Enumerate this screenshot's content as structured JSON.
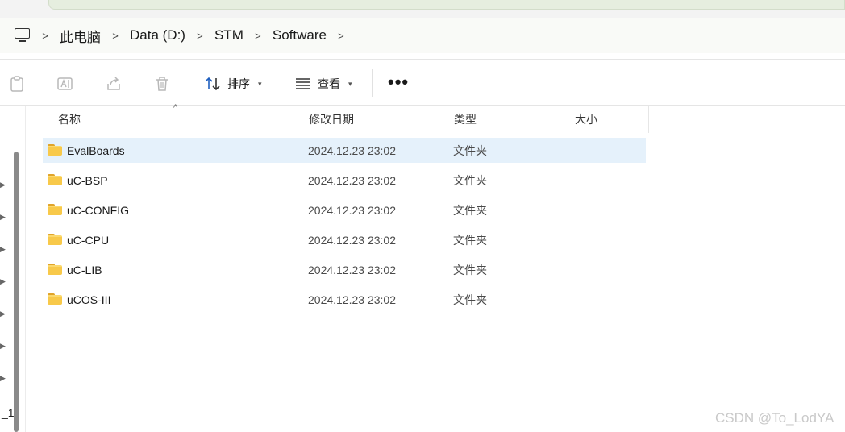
{
  "breadcrumb": {
    "items": [
      "此电脑",
      "Data (D:)",
      "STM",
      "Software"
    ]
  },
  "toolbar": {
    "sort_label": "排序",
    "view_label": "查看",
    "more_label": "•••"
  },
  "columns": [
    "名称",
    "修改日期",
    "类型",
    "大小"
  ],
  "files": [
    {
      "name": "EvalBoards",
      "date": "2024.12.23 23:02",
      "type": "文件夹"
    },
    {
      "name": "uC-BSP",
      "date": "2024.12.23 23:02",
      "type": "文件夹"
    },
    {
      "name": "uC-CONFIG",
      "date": "2024.12.23 23:02",
      "type": "文件夹"
    },
    {
      "name": "uC-CPU",
      "date": "2024.12.23 23:02",
      "type": "文件夹"
    },
    {
      "name": "uC-LIB",
      "date": "2024.12.23 23:02",
      "type": "文件夹"
    },
    {
      "name": "uCOS-III",
      "date": "2024.12.23 23:02",
      "type": "文件夹"
    }
  ],
  "nav": {
    "fragment": "_1"
  },
  "watermark": "CSDN @To_LodYA",
  "colors": {
    "selected_row": "#e5f1fb",
    "folder": "#f8c94a"
  }
}
